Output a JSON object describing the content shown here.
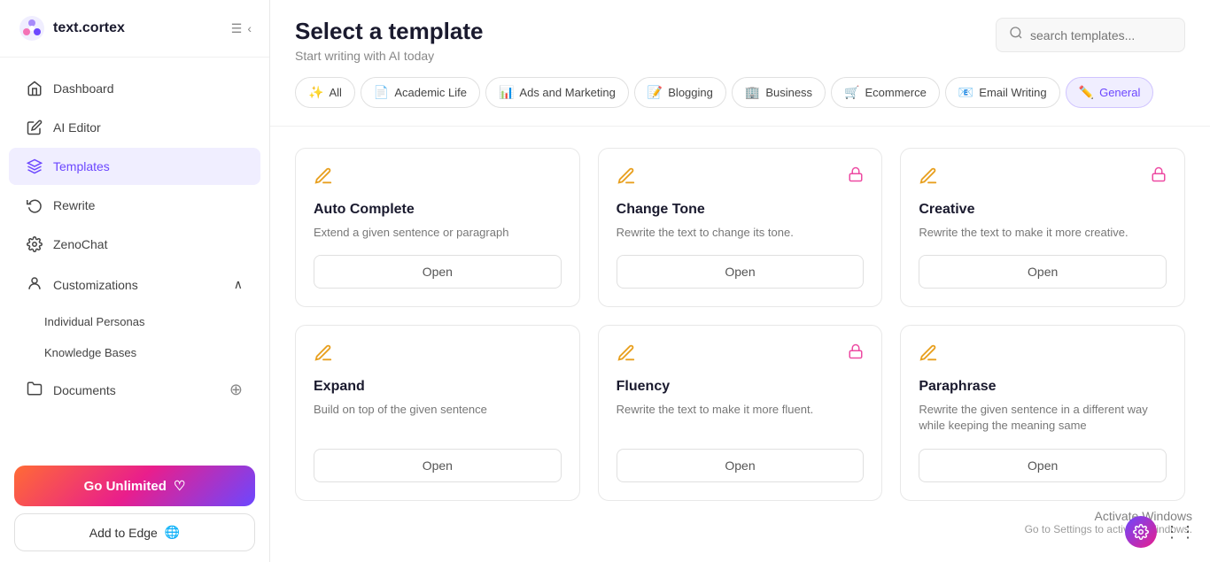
{
  "app": {
    "logo_text": "text.cortex",
    "logo_icon": "🌸"
  },
  "sidebar": {
    "nav_items": [
      {
        "id": "dashboard",
        "label": "Dashboard",
        "icon": "🏠"
      },
      {
        "id": "ai-editor",
        "label": "AI Editor",
        "icon": "✏️"
      },
      {
        "id": "templates",
        "label": "Templates",
        "icon": "📋",
        "active": true
      },
      {
        "id": "rewrite",
        "label": "Rewrite",
        "icon": "🔄"
      },
      {
        "id": "zenochat",
        "label": "ZenoChat",
        "icon": "⚙️"
      }
    ],
    "customizations_label": "Customizations",
    "individual_personas_label": "Individual Personas",
    "knowledge_bases_label": "Knowledge Bases",
    "documents_label": "Documents",
    "go_unlimited_label": "Go Unlimited",
    "add_to_edge_label": "Add to Edge"
  },
  "main": {
    "page_title": "Select a template",
    "page_subtitle": "Start writing with AI today",
    "search_placeholder": "search templates..."
  },
  "filter_tabs": [
    {
      "id": "all",
      "label": "All",
      "icon": "✨",
      "active": false
    },
    {
      "id": "academic-life",
      "label": "Academic Life",
      "icon": "📄"
    },
    {
      "id": "ads-marketing",
      "label": "Ads and Marketing",
      "icon": "📊"
    },
    {
      "id": "blogging",
      "label": "Blogging",
      "icon": "📝"
    },
    {
      "id": "business",
      "label": "Business",
      "icon": "🏢"
    },
    {
      "id": "ecommerce",
      "label": "Ecommerce",
      "icon": "🛒"
    },
    {
      "id": "email-writing",
      "label": "Email Writing",
      "icon": "📧"
    },
    {
      "id": "general",
      "label": "General",
      "icon": "✏️",
      "active": true
    }
  ],
  "templates": [
    {
      "id": "auto-complete",
      "title": "Auto Complete",
      "description": "Extend a given sentence or paragraph",
      "has_lock": false,
      "open_label": "Open"
    },
    {
      "id": "change-tone",
      "title": "Change Tone",
      "description": "Rewrite the text to change its tone.",
      "has_lock": true,
      "open_label": "Open"
    },
    {
      "id": "creative",
      "title": "Creative",
      "description": "Rewrite the text to make it more creative.",
      "has_lock": true,
      "open_label": "Open"
    },
    {
      "id": "expand",
      "title": "Expand",
      "description": "Build on top of the given sentence",
      "has_lock": false,
      "open_label": "Open"
    },
    {
      "id": "fluency",
      "title": "Fluency",
      "description": "Rewrite the text to make it more fluent.",
      "has_lock": true,
      "open_label": "Open"
    },
    {
      "id": "paraphrase",
      "title": "Paraphrase",
      "description": "Rewrite the given sentence in a different way while keeping the meaning same",
      "has_lock": false,
      "open_label": "Open"
    }
  ],
  "activate_windows": {
    "title": "Activate Windows",
    "subtitle": "Go to Settings to activate Windows."
  }
}
